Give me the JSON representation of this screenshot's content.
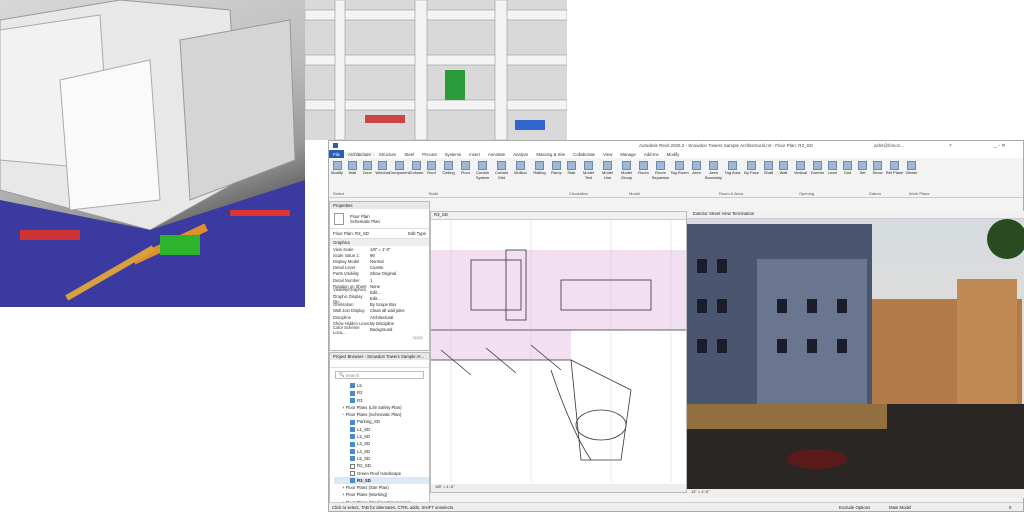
{
  "app": {
    "title": "Autodesk Revit 2025.2 - Snowdon Towers Sample Architectural.rvt - Floor Plan: R3_SD",
    "user": "ashit@bimon...",
    "help": "?"
  },
  "ribbon": {
    "tabs": [
      "File",
      "Architecture",
      "Structure",
      "Steel",
      "Precast",
      "Systems",
      "Insert",
      "Annotate",
      "Analyze",
      "Massing & Site",
      "Collaborate",
      "View",
      "Manage",
      "Add-Ins",
      "Modify"
    ],
    "tools": [
      "Modify",
      "Wall",
      "Door",
      "Window",
      "Component",
      "Column",
      "Roof",
      "Ceiling",
      "Floor",
      "Curtain System",
      "Curtain Grid",
      "Mullion",
      "Railing",
      "Ramp",
      "Stair",
      "Model Text",
      "Model Line",
      "Model Group",
      "Room",
      "Room Separator",
      "Tag Room",
      "Area",
      "Area Boundary",
      "Tag Area",
      "By Face",
      "Shaft",
      "Wall",
      "Vertical",
      "Dormer",
      "Level",
      "Grid",
      "Set",
      "Show",
      "Ref Plane",
      "Viewer"
    ],
    "groups": [
      "Select",
      "Build",
      "Circulation",
      "Model",
      "Room & Area",
      "Opening",
      "Datum",
      "Work Plane"
    ]
  },
  "properties": {
    "title": "Properties",
    "type_name": "Floor Plan",
    "type_sub": "Schematic Plan",
    "selector": "Floor Plan: R3_SD",
    "edit_type": "Edit Type",
    "section": "Graphics",
    "rows": [
      [
        "View Scale",
        "1/8\" = 1'-0\""
      ],
      [
        "Scale Value 1:",
        "96"
      ],
      [
        "Display Model",
        "Normal"
      ],
      [
        "Detail Level",
        "Coarse"
      ],
      [
        "Parts Visibility",
        "Show Original"
      ],
      [
        "Detail Number",
        "1"
      ],
      [
        "Rotation on Sheet",
        "None"
      ],
      [
        "Visibility/Graphics ...",
        "Edit..."
      ],
      [
        "Graphic Display Op...",
        "Edit..."
      ],
      [
        "Orientation",
        "By Scope Box"
      ],
      [
        "Wall Join Display",
        "Clean all wall joins"
      ],
      [
        "Discipline",
        "Architectural"
      ],
      [
        "Show Hidden Lines",
        "By Discipline"
      ],
      [
        "Color Scheme Loca...",
        "Background"
      ]
    ],
    "apply": "Apply"
  },
  "browser": {
    "title": "Project Browser - Snowdon Towers Sample Ar...",
    "search_placeholder": "Search",
    "items": [
      {
        "label": "L5",
        "indent": 2,
        "check": true
      },
      {
        "label": "R2",
        "indent": 2,
        "check": true
      },
      {
        "label": "R3",
        "indent": 2,
        "check": true
      },
      {
        "label": "Floor Plans (Life Safety Plan)",
        "indent": 1,
        "exp": "+"
      },
      {
        "label": "Floor Plans (Schematic Plan)",
        "indent": 1,
        "exp": "−"
      },
      {
        "label": "Parking_SD",
        "indent": 2,
        "check": true
      },
      {
        "label": "L1_SD",
        "indent": 2,
        "check": true
      },
      {
        "label": "L2_SD",
        "indent": 2,
        "check": true
      },
      {
        "label": "L3_SD",
        "indent": 2,
        "check": true
      },
      {
        "label": "L4_SD",
        "indent": 2,
        "check": true
      },
      {
        "label": "L5_SD",
        "indent": 2,
        "check": true
      },
      {
        "label": "R2_SD",
        "indent": 2,
        "check": false
      },
      {
        "label": "Green Roof Hardscape",
        "indent": 2,
        "check": false
      },
      {
        "label": "R3_SD",
        "indent": 2,
        "check": true,
        "sel": true
      },
      {
        "label": "Floor Plans (Site Plan)",
        "indent": 1,
        "exp": "+"
      },
      {
        "label": "Floor Plans (Working)",
        "indent": 1,
        "exp": "+"
      },
      {
        "label": "Floor Plans (Working Dimensions)",
        "indent": 1,
        "exp": "+"
      }
    ]
  },
  "views": {
    "plan_tab": "R3_SD",
    "photo_tab": "Exterior Street View Termination",
    "plan_scale": "1/8\" = 1'-0\"",
    "photo_scale": "12\" = 1'-0\""
  },
  "status": {
    "hint": "Click to select, TAB for alternates, CTRL adds, SHIFT unselects.",
    "model": "Main Model",
    "exclude": "Exclude Options",
    "filter": "0"
  }
}
